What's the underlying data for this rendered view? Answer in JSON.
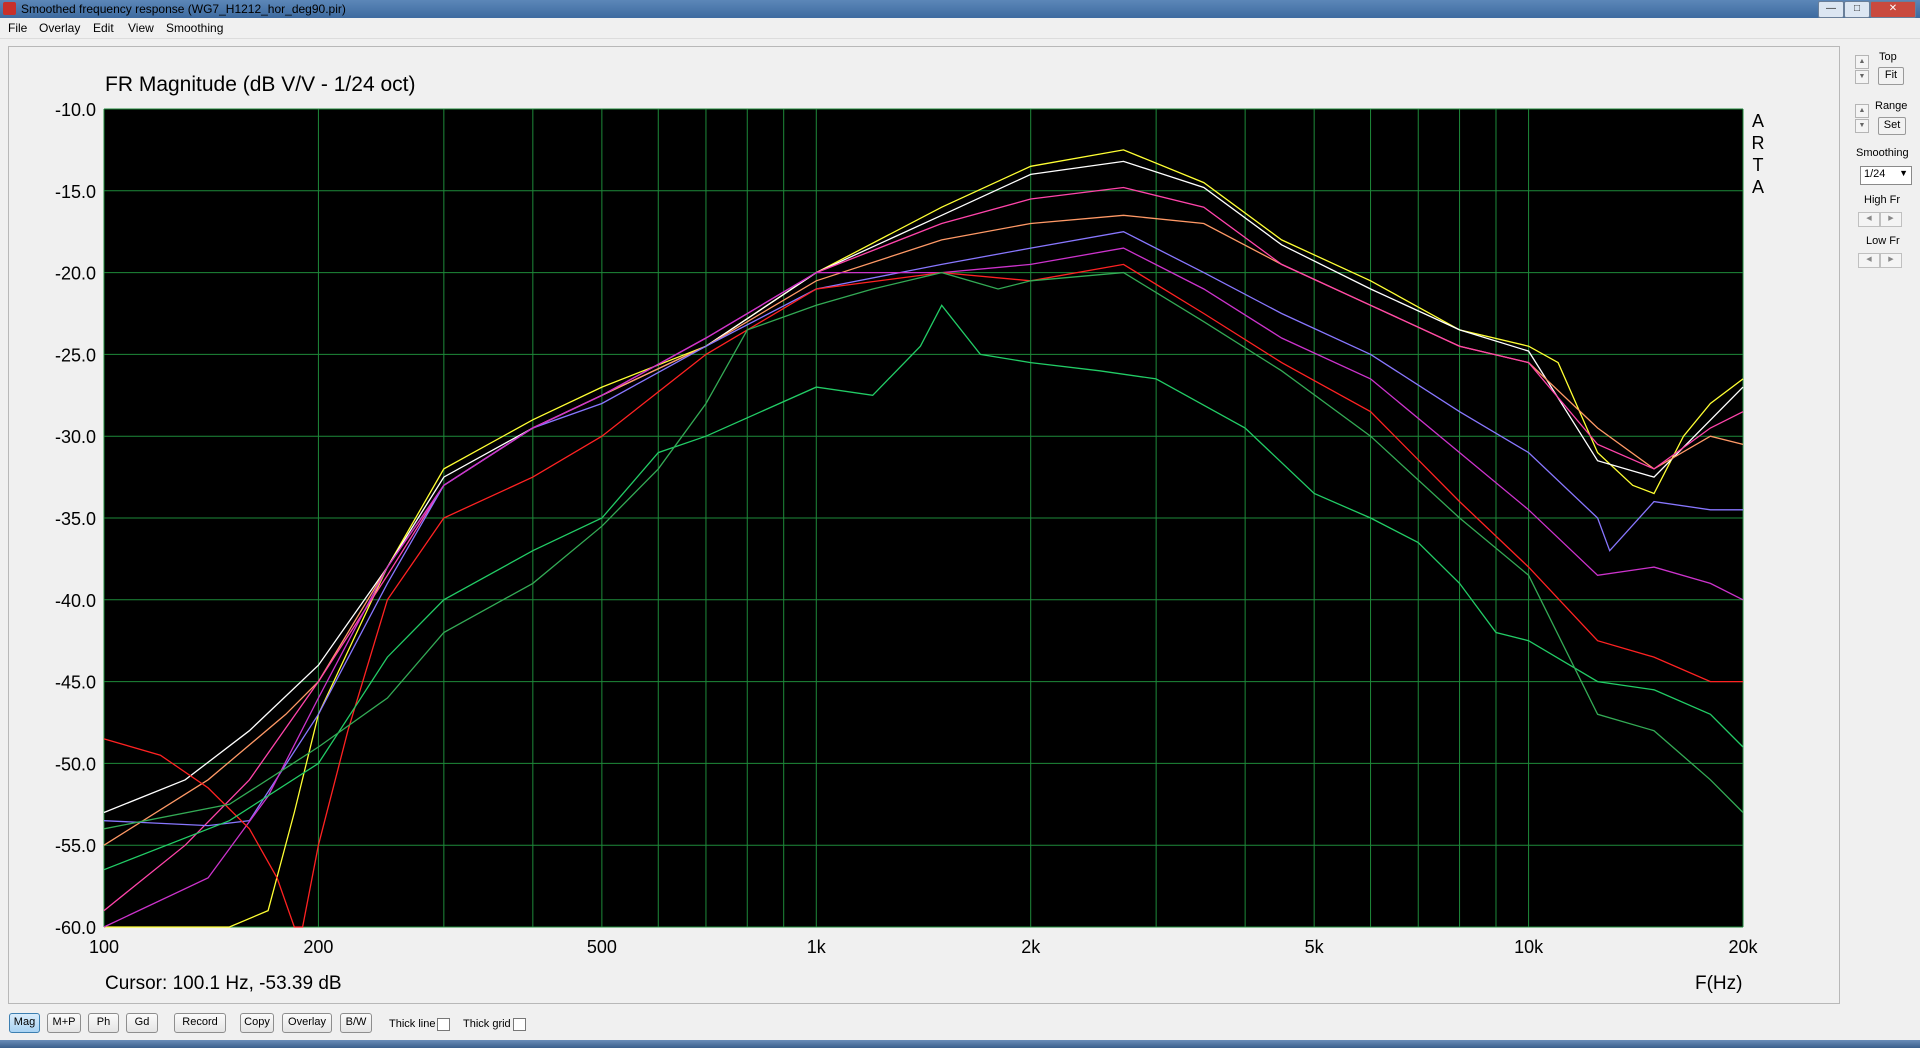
{
  "window": {
    "title": "Smoothed frequency response (WG7_H1212_hor_deg90.pir)"
  },
  "menu": [
    "File",
    "Overlay",
    "Edit",
    "View",
    "Smoothing"
  ],
  "right_panel": {
    "top_label": "Top",
    "fit_label": "Fit",
    "range_label": "Range",
    "set_label": "Set",
    "smoothing_label": "Smoothing",
    "smoothing_value": "1/24",
    "high_fr_label": "High Fr",
    "low_fr_label": "Low Fr"
  },
  "bottom_toolbar": {
    "buttons": [
      "Mag",
      "M+P",
      "Ph",
      "Gd",
      "Record",
      "Copy",
      "Overlay",
      "B/W"
    ],
    "active": "Mag",
    "thick_line_label": "Thick line",
    "thick_grid_label": "Thick grid"
  },
  "chart_data": {
    "type": "line",
    "title": "FR Magnitude (dB V/V - 1/24 oct)",
    "watermark": [
      "A",
      "R",
      "T",
      "A"
    ],
    "xlabel": "F(Hz)",
    "xscale": "log",
    "xlim": [
      100,
      20000
    ],
    "ylim": [
      -60,
      -10
    ],
    "yticks": [
      "-10.0",
      "-15.0",
      "-20.0",
      "-25.0",
      "-30.0",
      "-35.0",
      "-40.0",
      "-45.0",
      "-50.0",
      "-55.0",
      "-60.0"
    ],
    "xticks": [
      {
        "value": 100,
        "label": "100"
      },
      {
        "value": 200,
        "label": "200"
      },
      {
        "value": 500,
        "label": "500"
      },
      {
        "value": 1000,
        "label": "1k"
      },
      {
        "value": 2000,
        "label": "2k"
      },
      {
        "value": 5000,
        "label": "5k"
      },
      {
        "value": 10000,
        "label": "10k"
      },
      {
        "value": 20000,
        "label": "20k"
      }
    ],
    "cursor_text": "Cursor: 100.1 Hz, -53.39 dB",
    "background": "#000000",
    "grid_color": "#1e8a3a",
    "series": [
      {
        "color": "#ffff33",
        "points": [
          [
            100,
            -60
          ],
          [
            150,
            -60
          ],
          [
            170,
            -59
          ],
          [
            185,
            -53
          ],
          [
            200,
            -47
          ],
          [
            250,
            -38
          ],
          [
            300,
            -32
          ],
          [
            400,
            -29
          ],
          [
            500,
            -27
          ],
          [
            700,
            -24.5
          ],
          [
            1000,
            -20
          ],
          [
            1500,
            -16
          ],
          [
            2000,
            -13.5
          ],
          [
            2700,
            -12.5
          ],
          [
            3500,
            -14.5
          ],
          [
            4500,
            -18
          ],
          [
            6000,
            -20.5
          ],
          [
            8000,
            -23.5
          ],
          [
            10000,
            -24.5
          ],
          [
            11000,
            -25.5
          ],
          [
            12500,
            -31
          ],
          [
            14000,
            -33
          ],
          [
            15000,
            -33.5
          ],
          [
            16500,
            -30
          ],
          [
            18000,
            -28
          ],
          [
            20000,
            -26.5
          ]
        ]
      },
      {
        "color": "#ffffff",
        "points": [
          [
            100,
            -53
          ],
          [
            130,
            -51
          ],
          [
            160,
            -48
          ],
          [
            200,
            -44
          ],
          [
            250,
            -38
          ],
          [
            300,
            -32.5
          ],
          [
            400,
            -29.5
          ],
          [
            500,
            -27.5
          ],
          [
            700,
            -24.5
          ],
          [
            1000,
            -20
          ],
          [
            1500,
            -16.5
          ],
          [
            2000,
            -14
          ],
          [
            2700,
            -13.2
          ],
          [
            3500,
            -14.8
          ],
          [
            4500,
            -18.3
          ],
          [
            6000,
            -21
          ],
          [
            8000,
            -23.5
          ],
          [
            10000,
            -24.8
          ],
          [
            12500,
            -31.5
          ],
          [
            15000,
            -32.5
          ],
          [
            20000,
            -27
          ]
        ]
      },
      {
        "color": "#ff9966",
        "points": [
          [
            100,
            -55
          ],
          [
            140,
            -51
          ],
          [
            180,
            -47
          ],
          [
            200,
            -45
          ],
          [
            250,
            -38
          ],
          [
            300,
            -33
          ],
          [
            400,
            -29.5
          ],
          [
            500,
            -27.5
          ],
          [
            700,
            -24.5
          ],
          [
            1000,
            -20.5
          ],
          [
            1500,
            -18
          ],
          [
            2000,
            -17
          ],
          [
            2700,
            -16.5
          ],
          [
            3500,
            -17
          ],
          [
            4500,
            -19.5
          ],
          [
            6000,
            -22
          ],
          [
            8000,
            -24.5
          ],
          [
            10000,
            -25.5
          ],
          [
            12500,
            -29.5
          ],
          [
            15000,
            -32
          ],
          [
            18000,
            -30
          ],
          [
            20000,
            -30.5
          ]
        ]
      },
      {
        "color": "#ff44aa",
        "points": [
          [
            100,
            -59
          ],
          [
            130,
            -55
          ],
          [
            160,
            -51
          ],
          [
            200,
            -45
          ],
          [
            250,
            -38.5
          ],
          [
            300,
            -33
          ],
          [
            400,
            -29.5
          ],
          [
            500,
            -27.5
          ],
          [
            700,
            -24
          ],
          [
            1000,
            -20
          ],
          [
            1500,
            -17
          ],
          [
            2000,
            -15.5
          ],
          [
            2700,
            -14.8
          ],
          [
            3500,
            -16
          ],
          [
            4500,
            -19.5
          ],
          [
            6000,
            -22
          ],
          [
            8000,
            -24.5
          ],
          [
            10000,
            -25.5
          ],
          [
            12500,
            -30.5
          ],
          [
            15000,
            -32
          ],
          [
            18000,
            -29.5
          ],
          [
            20000,
            -28.5
          ]
        ]
      },
      {
        "color": "#8877ff",
        "points": [
          [
            100,
            -53.5
          ],
          [
            140,
            -53.8
          ],
          [
            160,
            -53.5
          ],
          [
            200,
            -47
          ],
          [
            250,
            -39
          ],
          [
            300,
            -33
          ],
          [
            400,
            -29.5
          ],
          [
            500,
            -28
          ],
          [
            700,
            -24.5
          ],
          [
            1000,
            -21
          ],
          [
            1500,
            -19.5
          ],
          [
            2000,
            -18.5
          ],
          [
            2700,
            -17.5
          ],
          [
            3500,
            -20
          ],
          [
            4500,
            -22.5
          ],
          [
            6000,
            -25
          ],
          [
            8000,
            -28.5
          ],
          [
            10000,
            -31
          ],
          [
            12500,
            -35
          ],
          [
            13000,
            -37
          ],
          [
            15000,
            -34
          ],
          [
            18000,
            -34.5
          ],
          [
            20000,
            -34.5
          ]
        ]
      },
      {
        "color": "#cc33cc",
        "points": [
          [
            100,
            -60
          ],
          [
            140,
            -57
          ],
          [
            170,
            -52
          ],
          [
            200,
            -46
          ],
          [
            250,
            -38
          ],
          [
            300,
            -33
          ],
          [
            400,
            -29.5
          ],
          [
            500,
            -27.5
          ],
          [
            700,
            -24
          ],
          [
            1000,
            -20
          ],
          [
            1500,
            -20
          ],
          [
            2000,
            -19.5
          ],
          [
            2700,
            -18.5
          ],
          [
            3500,
            -21
          ],
          [
            4500,
            -24
          ],
          [
            6000,
            -26.5
          ],
          [
            8000,
            -31
          ],
          [
            10000,
            -34.5
          ],
          [
            12500,
            -38.5
          ],
          [
            15000,
            -38
          ],
          [
            18000,
            -39
          ],
          [
            20000,
            -40
          ]
        ]
      },
      {
        "color": "#ff2222",
        "points": [
          [
            100,
            -48.5
          ],
          [
            120,
            -49.5
          ],
          [
            140,
            -51.5
          ],
          [
            160,
            -54
          ],
          [
            175,
            -57
          ],
          [
            185,
            -60
          ],
          [
            190,
            -60
          ],
          [
            200,
            -55
          ],
          [
            220,
            -48
          ],
          [
            250,
            -40
          ],
          [
            300,
            -35
          ],
          [
            400,
            -32.5
          ],
          [
            500,
            -30
          ],
          [
            700,
            -25
          ],
          [
            1000,
            -21
          ],
          [
            1500,
            -20
          ],
          [
            2000,
            -20.5
          ],
          [
            2700,
            -19.5
          ],
          [
            3500,
            -22.5
          ],
          [
            4500,
            -25.5
          ],
          [
            6000,
            -28.5
          ],
          [
            8000,
            -34
          ],
          [
            10000,
            -38
          ],
          [
            12500,
            -42.5
          ],
          [
            15000,
            -43.5
          ],
          [
            18000,
            -45
          ],
          [
            20000,
            -45
          ]
        ]
      },
      {
        "color": "#22cc66",
        "points": [
          [
            100,
            -56.5
          ],
          [
            150,
            -53.5
          ],
          [
            200,
            -50
          ],
          [
            250,
            -43.5
          ],
          [
            300,
            -40
          ],
          [
            400,
            -37
          ],
          [
            500,
            -35
          ],
          [
            600,
            -31
          ],
          [
            700,
            -30
          ],
          [
            1000,
            -27
          ],
          [
            1200,
            -27.5
          ],
          [
            1400,
            -24.5
          ],
          [
            1500,
            -22
          ],
          [
            1700,
            -25
          ],
          [
            2000,
            -25.5
          ],
          [
            2500,
            -26
          ],
          [
            3000,
            -26.5
          ],
          [
            4000,
            -29.5
          ],
          [
            5000,
            -33.5
          ],
          [
            6000,
            -35
          ],
          [
            7000,
            -36.5
          ],
          [
            8000,
            -39
          ],
          [
            9000,
            -42
          ],
          [
            10000,
            -42.5
          ],
          [
            12500,
            -45
          ],
          [
            15000,
            -45.5
          ],
          [
            18000,
            -47
          ],
          [
            20000,
            -49
          ]
        ]
      },
      {
        "color": "#33aa55",
        "points": [
          [
            100,
            -54
          ],
          [
            150,
            -52.5
          ],
          [
            200,
            -49
          ],
          [
            250,
            -46
          ],
          [
            300,
            -42
          ],
          [
            400,
            -39
          ],
          [
            500,
            -35.5
          ],
          [
            600,
            -32
          ],
          [
            700,
            -28
          ],
          [
            800,
            -23.5
          ],
          [
            1000,
            -22
          ],
          [
            1200,
            -21
          ],
          [
            1500,
            -20
          ],
          [
            1800,
            -21
          ],
          [
            2000,
            -20.5
          ],
          [
            2700,
            -20
          ],
          [
            3500,
            -23
          ],
          [
            4500,
            -26
          ],
          [
            6000,
            -30
          ],
          [
            8000,
            -35
          ],
          [
            10000,
            -38.5
          ],
          [
            12500,
            -47
          ],
          [
            15000,
            -48
          ],
          [
            18000,
            -51
          ],
          [
            20000,
            -53
          ]
        ]
      }
    ]
  }
}
